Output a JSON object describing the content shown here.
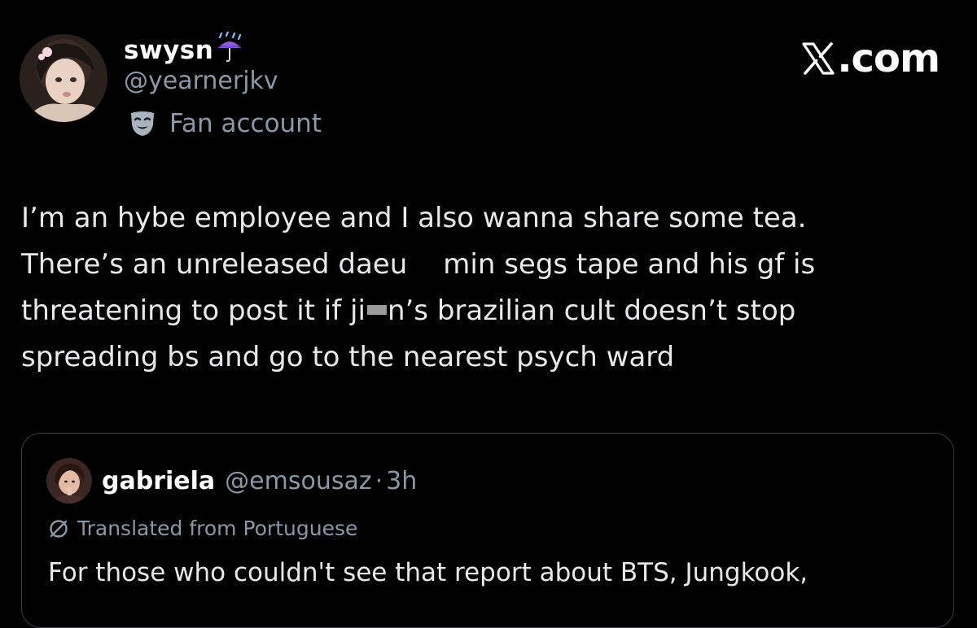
{
  "author": {
    "display_name": "swysn",
    "name_emoji_icon": "umbrella-with-rain-icon",
    "handle": "@yearnerjkv",
    "affiliation_icon": "theater-mask-icon",
    "affiliation_label": "Fan account"
  },
  "brand": {
    "logo_icon": "x-logo-icon",
    "text": ".com"
  },
  "tweet": {
    "line1": "I’m an hybe employee and I also wanna share some tea.",
    "line2_a": "There’s an unreleased daeu",
    "line2_b": "min segs tape and his gf is",
    "line3_a": "threatening to post it if ji",
    "line3_b": "n’s brazilian cult doesn’t stop",
    "line4": "spreading bs and go to the nearest psych ward"
  },
  "quote": {
    "display_name": "gabriela",
    "handle": "@emsousaz",
    "separator": "·",
    "time": "3h",
    "translate_icon": "translate-icon",
    "translated_label": "Translated from Portuguese",
    "text": "For those who couldn't see that report about BTS, Jungkook,"
  },
  "colors": {
    "background": "#000000",
    "primary_text": "#e7e9ea",
    "secondary_text": "#8b98a5",
    "border": "#3a3e43"
  }
}
